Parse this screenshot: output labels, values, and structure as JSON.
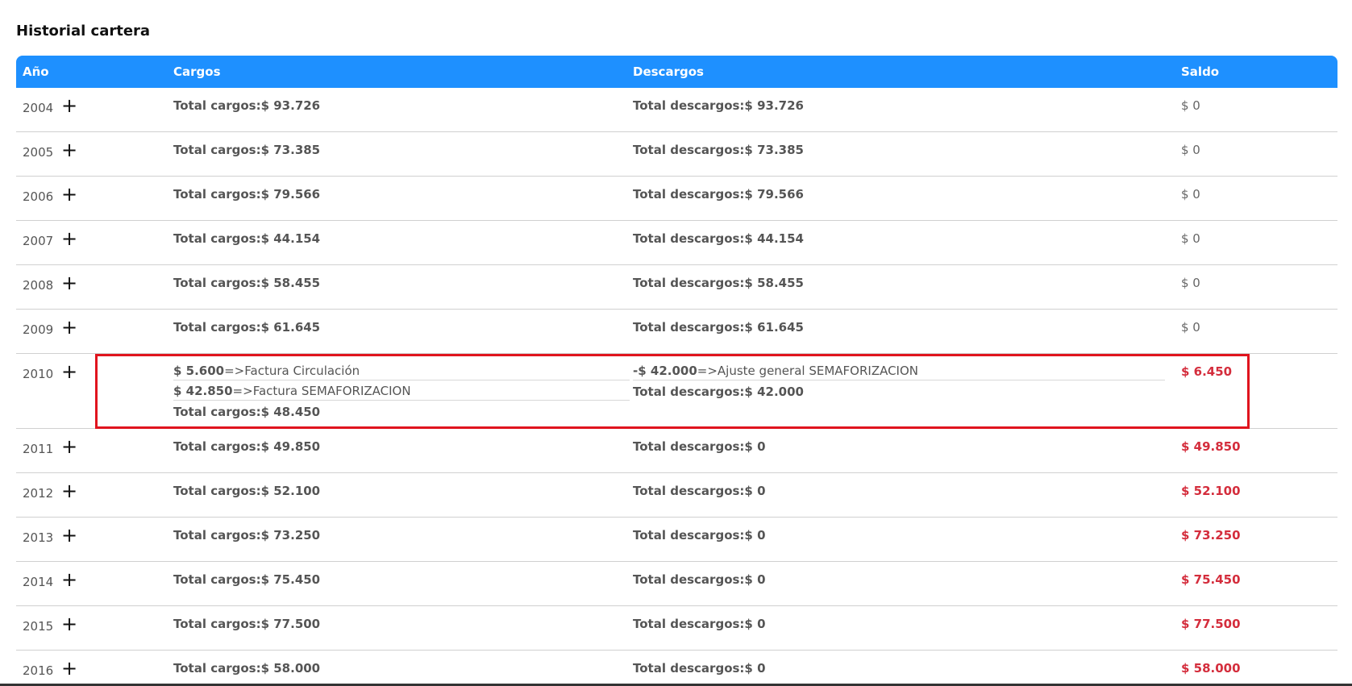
{
  "title": "Historial cartera",
  "headers": {
    "anio": "Año",
    "cargos": "Cargos",
    "descargos": "Descargos",
    "saldo": "Saldo"
  },
  "colors": {
    "header_bg": "#1e90ff",
    "saldo_red": "#d42d3c",
    "highlight": "#e0141e"
  },
  "rows": [
    {
      "year": "2004",
      "cargos": "Total cargos:$ 93.726",
      "descargos": "Total descargos:$ 93.726",
      "saldo": "$ 0"
    },
    {
      "year": "2005",
      "cargos": "Total cargos:$ 73.385",
      "descargos": "Total descargos:$ 73.385",
      "saldo": "$ 0"
    },
    {
      "year": "2006",
      "cargos": "Total cargos:$ 79.566",
      "descargos": "Total descargos:$ 79.566",
      "saldo": "$ 0"
    },
    {
      "year": "2007",
      "cargos": "Total cargos:$ 44.154",
      "descargos": "Total descargos:$ 44.154",
      "saldo": "$ 0"
    },
    {
      "year": "2008",
      "cargos": "Total cargos:$ 58.455",
      "descargos": "Total descargos:$ 58.455",
      "saldo": "$ 0"
    },
    {
      "year": "2009",
      "cargos": "Total cargos:$ 61.645",
      "descargos": "Total descargos:$ 61.645",
      "saldo": "$ 0"
    }
  ],
  "expanded_row": {
    "year": "2010",
    "cargo_items": [
      {
        "amount": "$ 5.600",
        "arrow": "=>",
        "desc": "Factura Circulación"
      },
      {
        "amount": "$ 42.850",
        "arrow": "=>",
        "desc": "Factura SEMAFORIZACION"
      }
    ],
    "cargos_total": "Total cargos:$ 48.450",
    "descargo_items": [
      {
        "amount": "-$ 42.000",
        "arrow": "=>",
        "desc": "Ajuste general SEMAFORIZACION"
      }
    ],
    "descargos_total": "Total descargos:$ 42.000",
    "saldo": "$ 6.450"
  },
  "rows_after": [
    {
      "year": "2011",
      "cargos": "Total cargos:$ 49.850",
      "descargos": "Total descargos:$ 0",
      "saldo": "$ 49.850"
    },
    {
      "year": "2012",
      "cargos": "Total cargos:$ 52.100",
      "descargos": "Total descargos:$ 0",
      "saldo": "$ 52.100"
    },
    {
      "year": "2013",
      "cargos": "Total cargos:$ 73.250",
      "descargos": "Total descargos:$ 0",
      "saldo": "$ 73.250"
    },
    {
      "year": "2014",
      "cargos": "Total cargos:$ 75.450",
      "descargos": "Total descargos:$ 0",
      "saldo": "$ 75.450"
    },
    {
      "year": "2015",
      "cargos": "Total cargos:$ 77.500",
      "descargos": "Total descargos:$ 0",
      "saldo": "$ 77.500"
    },
    {
      "year": "2016",
      "cargos": "Total cargos:$ 58.000",
      "descargos": "Total descargos:$ 0",
      "saldo": "$ 58.000"
    }
  ],
  "expand_symbol": "+"
}
